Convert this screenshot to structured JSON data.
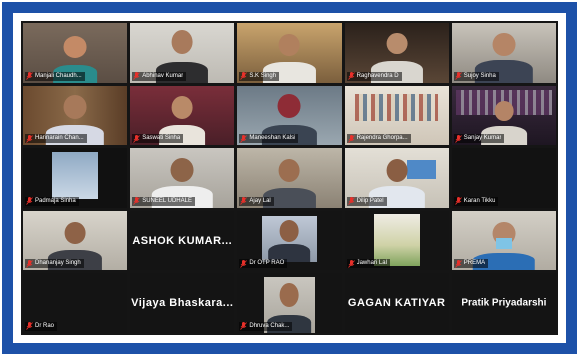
{
  "colors": {
    "frame_border": "#1d51a8",
    "grid_background": "#151515",
    "active_speaker_outline": "#c7e23a",
    "muted_mic": "#e8302a"
  },
  "participants": [
    {
      "name": "Manjali Chaudh...",
      "muted": true
    },
    {
      "name": "Abhinav Kumar",
      "muted": true
    },
    {
      "name": "S.K Singh",
      "muted": true
    },
    {
      "name": "Raghavendra D",
      "muted": true
    },
    {
      "name": "Sujoy Sinha",
      "muted": true
    },
    {
      "name": "Harinarain Chan...",
      "muted": true
    },
    {
      "name": "Saswati Sinha",
      "muted": true
    },
    {
      "name": "Maneeshan Kalsi",
      "muted": true
    },
    {
      "name": "Rajendra Ghorpa...",
      "muted": true
    },
    {
      "name": "Sanjay Kumar",
      "muted": true
    },
    {
      "name": "Padmaja Sinha",
      "muted": true
    },
    {
      "name": "SUNEEL UDHALE",
      "muted": true
    },
    {
      "name": "Ajay Lal",
      "muted": true
    },
    {
      "name": "Dilip Patel",
      "muted": true,
      "active": true
    },
    {
      "name": "Karan Tikku",
      "muted": true
    },
    {
      "name": "Dhananjay Singh",
      "muted": true
    },
    {
      "name": "ASHOK KUMAR...",
      "muted": true,
      "display_name": "ASHOK  KUMAR..."
    },
    {
      "name": "Dr OTP RAO",
      "muted": true
    },
    {
      "name": "Jawhari Lal",
      "muted": true
    },
    {
      "name": "PREMA",
      "muted": true
    },
    {
      "name": "Dr Rao",
      "muted": true
    },
    {
      "name": "Vijaya Bhaskara...",
      "muted": true,
      "display_name": "Vijaya  Bhaskara..."
    },
    {
      "name": "Dhruva Chak...",
      "muted": true
    },
    {
      "name": "GAGAN KATIYAR",
      "muted": true,
      "display_name": "GAGAN KATIYAR"
    },
    {
      "name": "Pratik Priyadarshi",
      "muted": true,
      "display_name": "Pratik Priyadarshi"
    }
  ]
}
